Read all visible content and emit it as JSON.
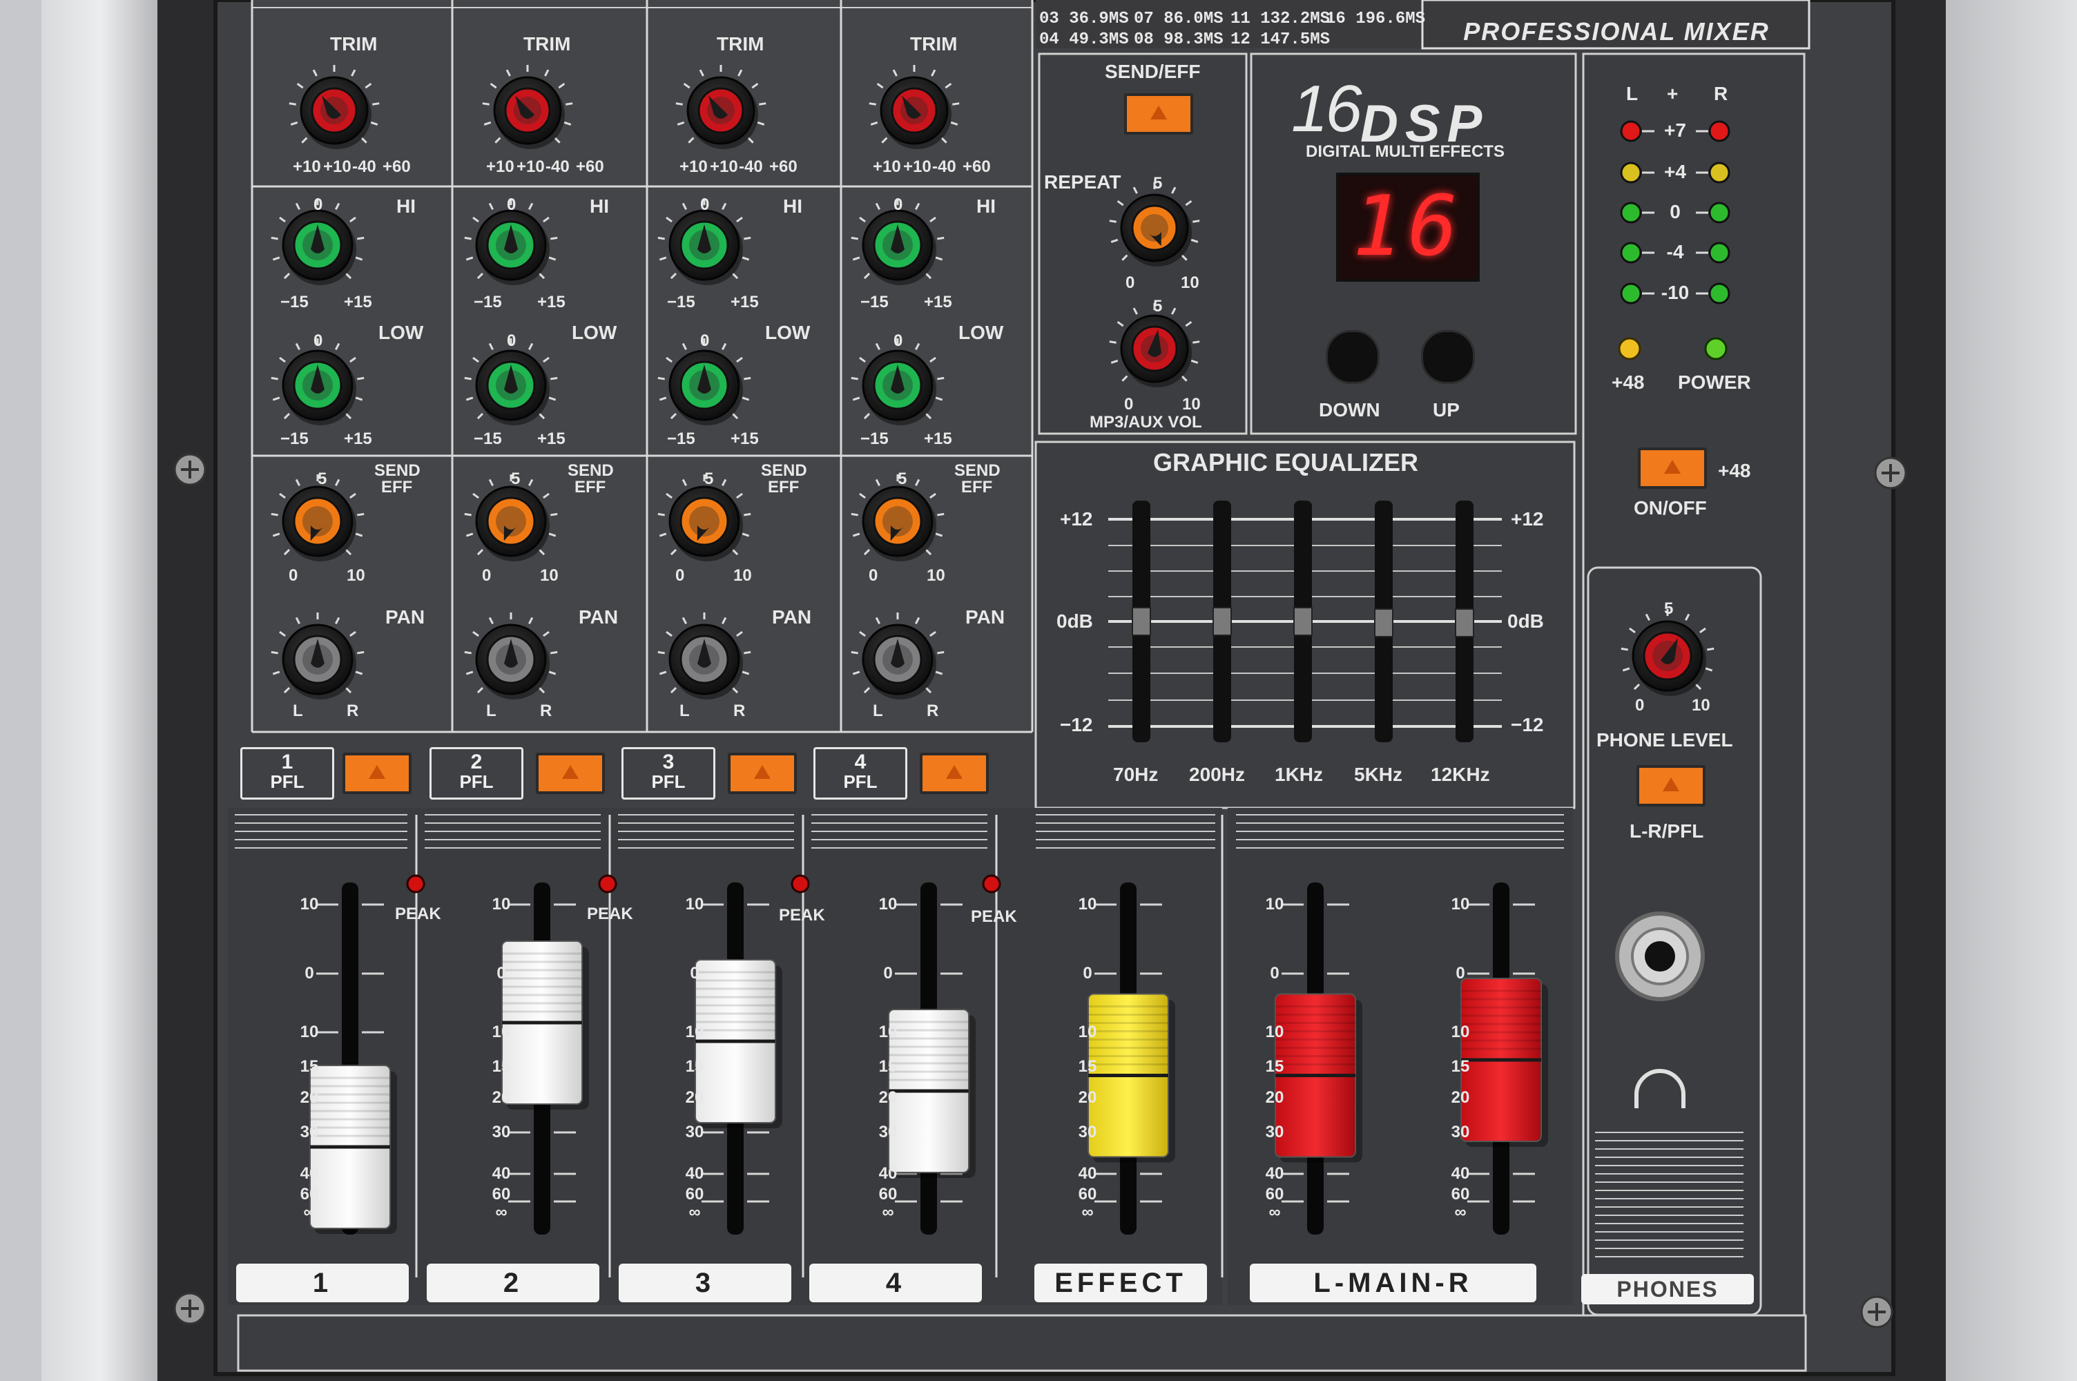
{
  "brand": {
    "product": "PROFESSIONAL MIXER",
    "dsp_number": "16",
    "dsp_word": "DSP",
    "dsp_sub": "DIGITAL MULTI EFFECTS"
  },
  "effect_table_partial": [
    "03 36.9MS",
    "07 86.0MS",
    "11 132.2MS",
    "16 196.6MS",
    "04 49.3MS",
    "08 98.3MS",
    "12 147.5MS"
  ],
  "channels": [
    {
      "number": "1",
      "fader_label": "1",
      "fader_level": 0.22
    },
    {
      "number": "2",
      "fader_label": "2",
      "fader_level": 0.62
    },
    {
      "number": "3",
      "fader_label": "3",
      "fader_level": 0.56
    },
    {
      "number": "4",
      "fader_label": "4",
      "fader_level": 0.4
    }
  ],
  "channel_strip_labels": {
    "trim": "TRIM",
    "trim_scale": [
      "+10",
      "+10",
      "-40",
      "+60"
    ],
    "hi": "HI",
    "low": "LOW",
    "eq_min": "−15",
    "eq_max": "+15",
    "eq_center": "0",
    "send_eff_1": "SEND",
    "send_eff_2": "EFF",
    "send_min": "0",
    "send_mid": "5",
    "send_max": "10",
    "pan": "PAN",
    "pan_l": "L",
    "pan_r": "R",
    "pfl": "PFL",
    "peak": "PEAK"
  },
  "effects_section": {
    "send_eff": "SEND/EFF",
    "repeat": "REPEAT",
    "repeat_min": "0",
    "repeat_mid": "5",
    "repeat_max": "10",
    "mp3_vol": "MP3/AUX VOL",
    "mp3_min": "0",
    "mp3_mid": "5",
    "mp3_max": "10",
    "display_value": "16",
    "down": "DOWN",
    "up": "UP"
  },
  "meters": {
    "l": "L",
    "plus": "+",
    "r": "R",
    "levels": [
      "+7",
      "+4",
      "0",
      "-4",
      "-10"
    ],
    "phantom": "+48",
    "power": "POWER",
    "level_colors": [
      "#e01818",
      "#d8c020",
      "#2dbb2d",
      "#2dbb2d",
      "#2dbb2d"
    ]
  },
  "phantom_switch": {
    "label": "ON/OFF",
    "tag": "+48"
  },
  "graphic_eq": {
    "title": "GRAPHIC EQUALIZER",
    "top": "+12",
    "mid": "0dB",
    "bottom": "−12",
    "bands": [
      "70Hz",
      "200Hz",
      "1KHz",
      "5KHz",
      "12KHz"
    ]
  },
  "phones": {
    "level": "PHONE LEVEL",
    "level_min": "0",
    "level_mid": "5",
    "level_max": "10",
    "switch": "L-R/PFL",
    "label": "PHONES"
  },
  "fader_scale": [
    "10",
    "0",
    "10",
    "15",
    "20",
    "30",
    "40",
    "60",
    "∞"
  ],
  "master_faders": {
    "effect": {
      "label": "EFFECT",
      "level": 0.45
    },
    "main": {
      "label": "L-MAIN-R",
      "level_l": 0.45,
      "level_r": 0.5
    }
  }
}
